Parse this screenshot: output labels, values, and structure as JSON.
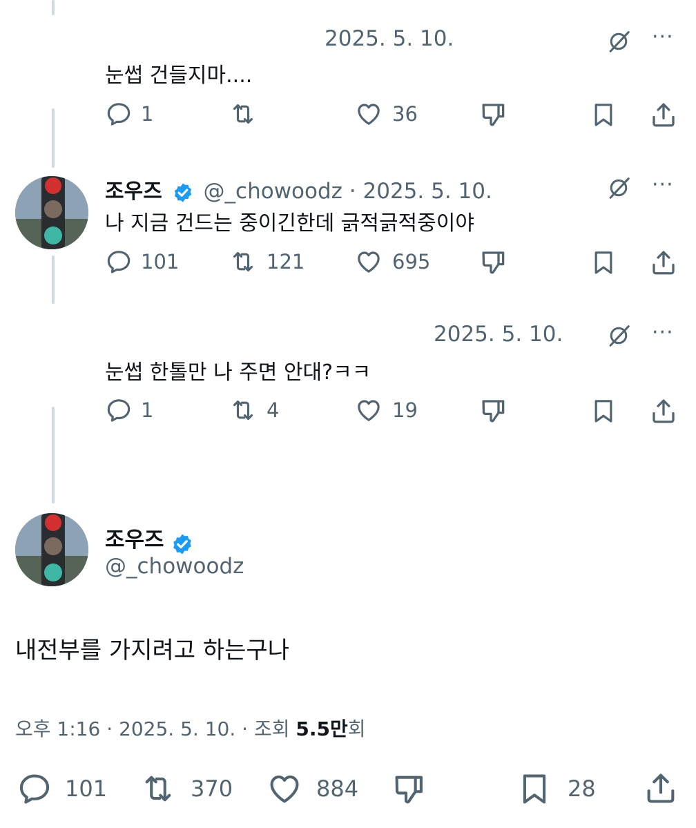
{
  "tweets": [
    {
      "timestamp": "2025. 5. 10.",
      "text": "눈썹 건들지마....",
      "replies": "1",
      "reposts": "",
      "likes": "36"
    },
    {
      "author_name": "조우즈",
      "handle": "@_chowoodz",
      "separator": "·",
      "timestamp": "2025. 5. 10.",
      "text": "나 지금 건드는 중이긴한데 긁적긁적중이야",
      "replies": "101",
      "reposts": "121",
      "likes": "695"
    },
    {
      "timestamp": "2025. 5. 10.",
      "text": "눈썹 한톨만 나 주면 안대?ㅋㅋ",
      "replies": "1",
      "reposts": "4",
      "likes": "19"
    }
  ],
  "main_tweet": {
    "author_name": "조우즈",
    "handle": "@_chowoodz",
    "text": "내전부를 가지려고 하는구나",
    "time": "오후 1:16",
    "separator": "·",
    "date": "2025. 5. 10.",
    "views_label": "조회",
    "views_number": "5.5만",
    "views_suffix": "회",
    "replies": "101",
    "reposts": "370",
    "likes": "884",
    "bookmarks": "28"
  },
  "icons": {
    "reply": "reply-icon",
    "repost": "repost-icon",
    "like": "heart-icon",
    "dislike": "thumbs-down-icon",
    "bookmark": "bookmark-icon",
    "share": "share-icon",
    "grok": "grok-icon",
    "more": "more-icon",
    "verified": "verified-badge-icon"
  },
  "colors": {
    "text": "#0f1419",
    "secondary": "#536471",
    "verified": "#1d9bf0",
    "thread_line": "#cfd9de"
  }
}
